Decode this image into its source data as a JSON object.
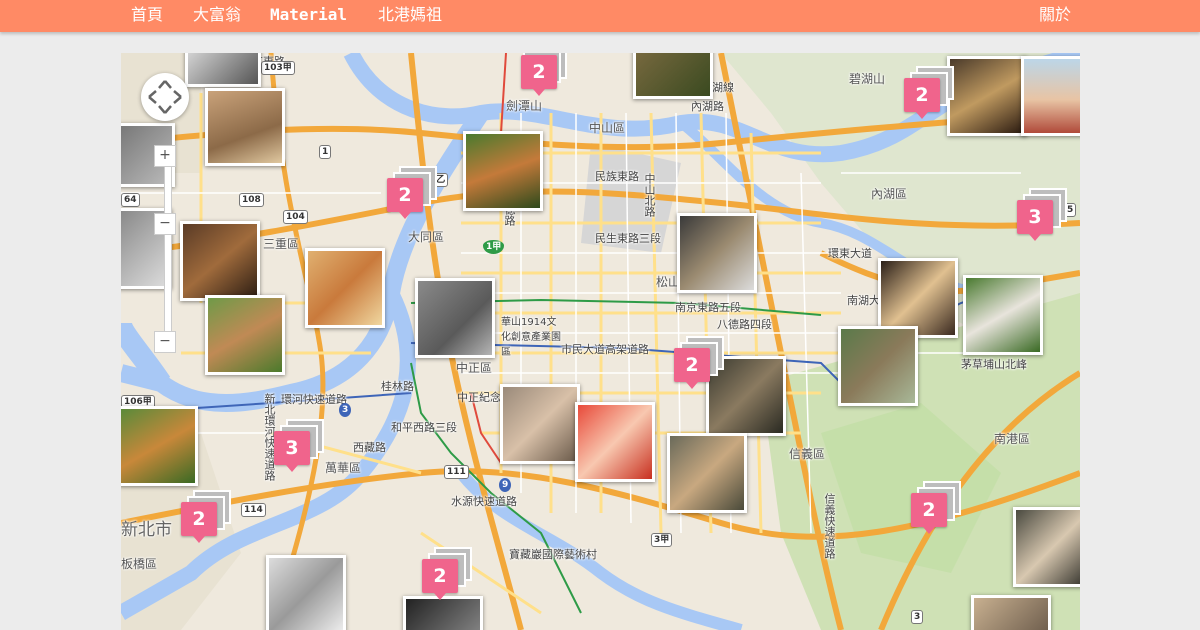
{
  "nav": {
    "items": [
      "首頁",
      "大富翁",
      "Material",
      "北港媽祖"
    ],
    "right": "關於"
  },
  "colors": {
    "header": "#ff8a65",
    "cluster_badge": "#f0648c",
    "highway": "#f2a83b",
    "road": "#ffe08a",
    "river": "#a8c8f5",
    "park": "#c5dfa9"
  },
  "map": {
    "labels": {
      "jiantan": "劍潭山",
      "zhongshan_district": "中山區",
      "neihu": "內湖區",
      "bihu": "碧湖山",
      "datong": "大同區",
      "songshan": "松山",
      "sanchong": "三重區",
      "zhongzheng": "中正區",
      "huashan": "華山1914文化創意產業園區",
      "wanhua": "萬華區",
      "xinyi": "信義區",
      "nangang": "南港區",
      "xinbei": "新北市",
      "banqiao": "板橋區",
      "tuanshan": "茅草埔山北峰",
      "treasure": "寶藏巖國際藝術村",
      "wenhu": "文湖線",
      "minsheng": "民生東路三段",
      "nanjing": "南京東路五段",
      "bade": "八德路四段",
      "civic": "市民大道高架道路",
      "zhongshan_n": "中山北路",
      "xiyuan": "西藏路",
      "heping": "和平西路三段",
      "taipei_hwy": "環河快速道路",
      "keelung_rd": "基隆路",
      "minzu": "民族東路",
      "huandong": "環東大道",
      "nanhu": "南湖大橋",
      "neihu_rd": "內湖路",
      "chengde": "承德路",
      "xinbei_hwy": "新北環河快速道路",
      "zhongxiao": "中正紀念",
      "guilin": "桂林路",
      "xin_hai": "信義快速道路",
      "shuiyuan": "水源快速道路",
      "nanjing_rd": "南京東路",
      "rt1": "1",
      "rt2": "2乙",
      "rt5": "5",
      "rt3": "3",
      "rt9": "9",
      "rt64": "64",
      "rt104": "104",
      "rt106": "106甲",
      "rt108": "108",
      "rt111": "111",
      "rt114": "114",
      "rt103": "103甲",
      "rt1b": "1甲",
      "rt3b": "3甲",
      "rt3c": "3"
    },
    "clusters": [
      "2",
      "2",
      "2",
      "3",
      "2",
      "3",
      "2",
      "2",
      "2"
    ],
    "controls": {
      "zoom_in": "+",
      "zoom_out": "−",
      "zoom_out2": "−"
    }
  }
}
